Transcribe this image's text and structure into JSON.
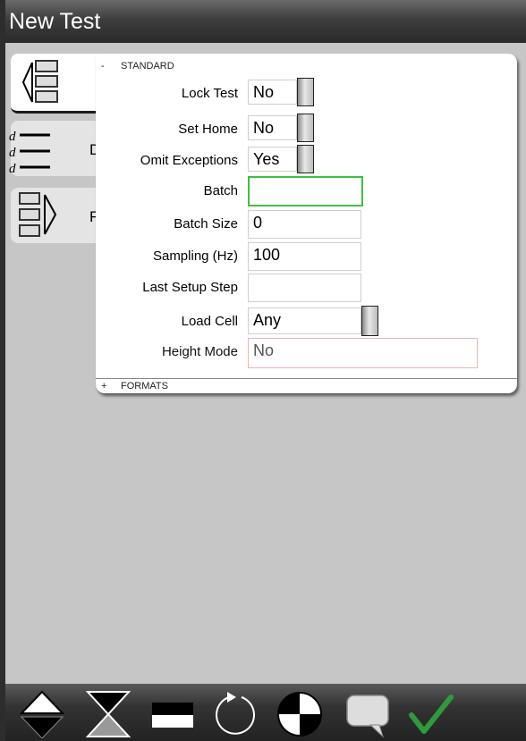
{
  "window": {
    "title": "New Test"
  },
  "tabs": [
    {
      "icon": "collapse-list-icon",
      "peek": ""
    },
    {
      "icon": "d-list-icon",
      "peek": "D"
    },
    {
      "icon": "expand-list-icon",
      "peek": "F"
    }
  ],
  "panel": {
    "section_standard": {
      "sign": "-",
      "label": "STANDARD"
    },
    "section_formats": {
      "sign": "+",
      "label": "FORMATS"
    },
    "fields": {
      "lock_test": {
        "label": "Lock Test",
        "value": "No"
      },
      "set_home": {
        "label": "Set Home",
        "value": "No"
      },
      "omit_exceptions": {
        "label": "Omit Exceptions",
        "value": "Yes"
      },
      "batch": {
        "label": "Batch",
        "value": ""
      },
      "batch_size": {
        "label": "Batch Size",
        "value": "0"
      },
      "sampling": {
        "label": "Sampling (Hz)",
        "value": "100"
      },
      "last_setup_step": {
        "label": "Last Setup Step",
        "value": ""
      },
      "load_cell": {
        "label": "Load Cell",
        "value": "Any"
      },
      "height_mode": {
        "label": "Height Mode",
        "value": "No"
      }
    }
  },
  "toolbar": {
    "icons": [
      "up-down-arrows-icon",
      "hourglass-icon",
      "rectangle-icon",
      "rotate-icon",
      "target-icon",
      "comment-icon",
      "checkmark-icon"
    ]
  },
  "colors": {
    "accent_focus": "#3fbf3f",
    "error_border": "#f2b4b4",
    "check": "#2e9a3c"
  }
}
